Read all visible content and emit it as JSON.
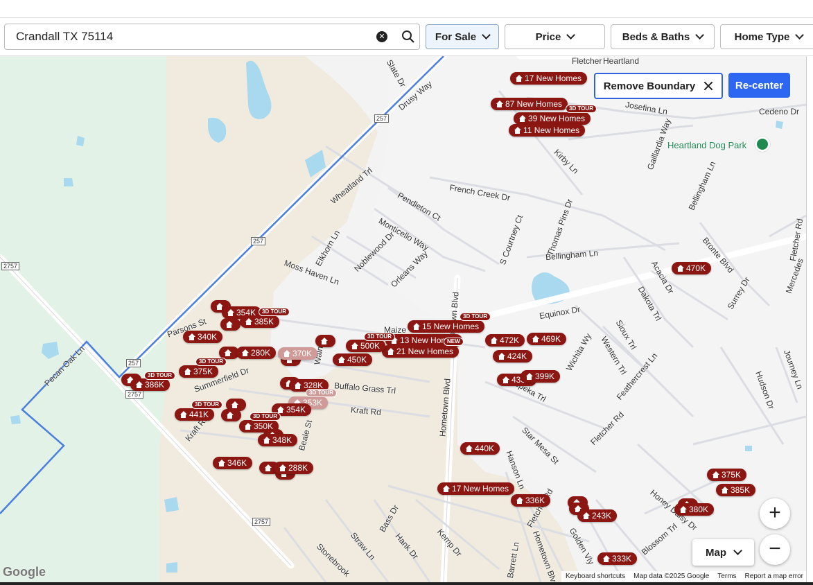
{
  "search": {
    "value": "Crandall TX 75114"
  },
  "filters": [
    {
      "label": "For Sale",
      "active": true
    },
    {
      "label": "Price",
      "active": false
    },
    {
      "label": "Beds & Baths",
      "active": false
    },
    {
      "label": "Home Type",
      "active": false
    }
  ],
  "map": {
    "remove_boundary_label": "Remove Boundary",
    "recenter_label": "Re-center",
    "map_type_label": "Map",
    "zoom_in_label": "+",
    "zoom_out_label": "−",
    "google_logo": "Google",
    "attribution": {
      "shortcuts": "Keyboard shortcuts",
      "data": "Map data ©2025 Google",
      "terms": "Terms",
      "report": "Report a map error"
    },
    "park_label": "Heartland Dog Park",
    "street_labels": [
      "Slate Dr",
      "Drusy Way",
      "Fletcher",
      "Cedeno Dr",
      "Kirby Ln",
      "Gaillardia Way",
      "Bellingham Ln",
      "Wheatland Trl",
      "French Creek Dr",
      "Pendleton Ct",
      "Monticello Way",
      "Elkhorn Ln",
      "Noblewood Dr",
      "Orleans Way",
      "Moss Haven Ln",
      "S Courtney Ct",
      "Thomas Pins Dr",
      "Bellingham Ln",
      "Acacia Dr",
      "Dakota Trl",
      "Bronte Blvd",
      "Surrey Dr",
      "Fletcher Rd",
      "Mercedes",
      "Equinox Dr",
      "Sioux Trl",
      "Western Trl",
      "Feathercrest Ln",
      "Wichita Wy",
      "Hudson Dr",
      "Journey Ln",
      "Topeka Trl",
      "Fletcher Rd",
      "Star Mesa St",
      "Hometown Blvd",
      "Buffalo Grass Trl",
      "Kraft Rd",
      "Maize",
      "Walnut",
      "Parsons St",
      "Summerfield Dr",
      "Kraft Rd",
      "Beale St",
      "Pecan Oak Ln",
      "Bass Dr",
      "Straw Ln",
      "Hank Dr",
      "Kemp Dr",
      "Stonebrook",
      "Barrett Ln",
      "Hometown Blvd",
      "Fletcher Rd",
      "Golden Vly",
      "Honey Daisy Dr",
      "Blossom Trl",
      "Hometown Blvd",
      "Hanson Ln",
      "Josefina Ln",
      "Heartland"
    ],
    "shields": [
      "257",
      "257",
      "2757",
      "257",
      "2757",
      "2757"
    ],
    "markers": [
      {
        "label": "17 New Homes",
        "faded": false
      },
      {
        "label": "87 New Homes",
        "faded": false
      },
      {
        "label": "39 New Homes",
        "faded": false
      },
      {
        "label": "11 New Homes",
        "faded": false
      },
      {
        "label": "470K",
        "faded": false
      },
      {
        "label": "15 New Homes",
        "faded": false
      },
      {
        "label": "13 New Homes",
        "faded": false
      },
      {
        "label": "21 New Homes",
        "faded": false
      },
      {
        "label": "472K",
        "faded": false
      },
      {
        "label": "469K",
        "faded": false
      },
      {
        "label": "424K",
        "faded": false
      },
      {
        "label": "399K",
        "faded": false
      },
      {
        "label": "433K",
        "faded": false
      },
      {
        "label": "354K",
        "faded": false
      },
      {
        "label": "385K",
        "faded": false
      },
      {
        "label": "340K",
        "faded": false
      },
      {
        "label": "280K",
        "faded": false
      },
      {
        "label": "370K",
        "faded": true
      },
      {
        "label": "500K",
        "faded": false
      },
      {
        "label": "450K",
        "faded": false
      },
      {
        "label": "375K",
        "faded": false
      },
      {
        "label": "386K",
        "faded": false
      },
      {
        "label": "328K",
        "faded": false
      },
      {
        "label": "353K",
        "faded": true
      },
      {
        "label": "441K",
        "faded": false
      },
      {
        "label": "354K",
        "faded": false
      },
      {
        "label": "350K",
        "faded": false
      },
      {
        "label": "348K",
        "faded": false
      },
      {
        "label": "346K",
        "faded": false
      },
      {
        "label": "288K",
        "faded": false
      },
      {
        "label": "440K",
        "faded": false
      },
      {
        "label": "17 New Homes",
        "faded": false
      },
      {
        "label": "336K",
        "faded": false
      },
      {
        "label": "243K",
        "faded": false
      },
      {
        "label": "333K",
        "faded": false
      },
      {
        "label": "375K",
        "faded": false
      },
      {
        "label": "385K",
        "faded": false
      },
      {
        "label": "380K",
        "faded": false
      }
    ],
    "tags": [
      "3D TOUR",
      "3D TOUR",
      "3D TOUR",
      "3D TOUR",
      "NEW",
      "3D TOUR",
      "3D TOUR",
      "3D TOUR",
      "3D TOUR",
      "3D TOUR"
    ]
  },
  "colors": {
    "marker": "#8b1612",
    "accent": "#2d66f0",
    "boundary": "#4a7ee0",
    "park": "#1e8a52"
  }
}
